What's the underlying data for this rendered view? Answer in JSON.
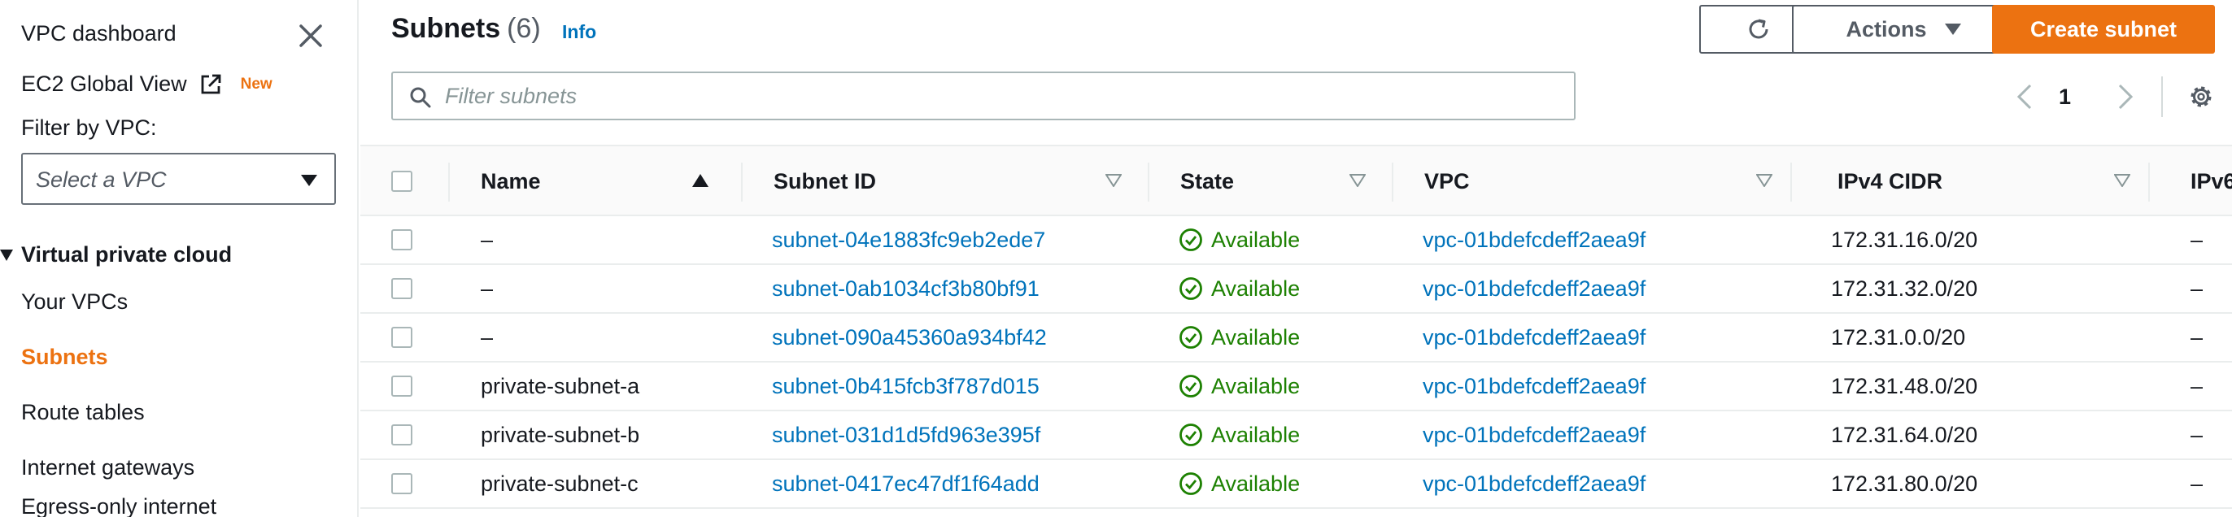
{
  "sidebar": {
    "title": "VPC dashboard",
    "ec2_global_view": "EC2 Global View",
    "new_badge": "New",
    "filter_label": "Filter by VPC:",
    "vpc_select_placeholder": "Select a VPC",
    "section_title": "Virtual private cloud",
    "items": [
      {
        "label": "Your VPCs",
        "active": false
      },
      {
        "label": "Subnets",
        "active": true
      },
      {
        "label": "Route tables",
        "active": false
      },
      {
        "label": "Internet gateways",
        "active": false
      },
      {
        "label": "Egress-only internet",
        "active": false
      }
    ]
  },
  "header": {
    "title": "Subnets",
    "count": "(6)",
    "info": "Info",
    "actions_label": "Actions",
    "create_label": "Create subnet"
  },
  "search": {
    "placeholder": "Filter subnets",
    "value": ""
  },
  "pagination": {
    "current_page": "1"
  },
  "table": {
    "columns": [
      "Name",
      "Subnet ID",
      "State",
      "VPC",
      "IPv4 CIDR",
      "IPv6"
    ],
    "rows": [
      {
        "name": "–",
        "subnet_id": "subnet-04e1883fc9eb2ede7",
        "state": "Available",
        "vpc": "vpc-01bdefcdeff2aea9f",
        "ipv4": "172.31.16.0/20",
        "ipv6": "–"
      },
      {
        "name": "–",
        "subnet_id": "subnet-0ab1034cf3b80bf91",
        "state": "Available",
        "vpc": "vpc-01bdefcdeff2aea9f",
        "ipv4": "172.31.32.0/20",
        "ipv6": "–"
      },
      {
        "name": "–",
        "subnet_id": "subnet-090a45360a934bf42",
        "state": "Available",
        "vpc": "vpc-01bdefcdeff2aea9f",
        "ipv4": "172.31.0.0/20",
        "ipv6": "–"
      },
      {
        "name": "private-subnet-a",
        "subnet_id": "subnet-0b415fcb3f787d015",
        "state": "Available",
        "vpc": "vpc-01bdefcdeff2aea9f",
        "ipv4": "172.31.48.0/20",
        "ipv6": "–"
      },
      {
        "name": "private-subnet-b",
        "subnet_id": "subnet-031d1d5fd963e395f",
        "state": "Available",
        "vpc": "vpc-01bdefcdeff2aea9f",
        "ipv4": "172.31.64.0/20",
        "ipv6": "–"
      },
      {
        "name": "private-subnet-c",
        "subnet_id": "subnet-0417ec47df1f64add",
        "state": "Available",
        "vpc": "vpc-01bdefcdeff2aea9f",
        "ipv4": "172.31.80.0/20",
        "ipv6": "–"
      }
    ]
  },
  "colors": {
    "accent": "#ec7211",
    "link": "#0073bb",
    "available": "#1d8102"
  }
}
